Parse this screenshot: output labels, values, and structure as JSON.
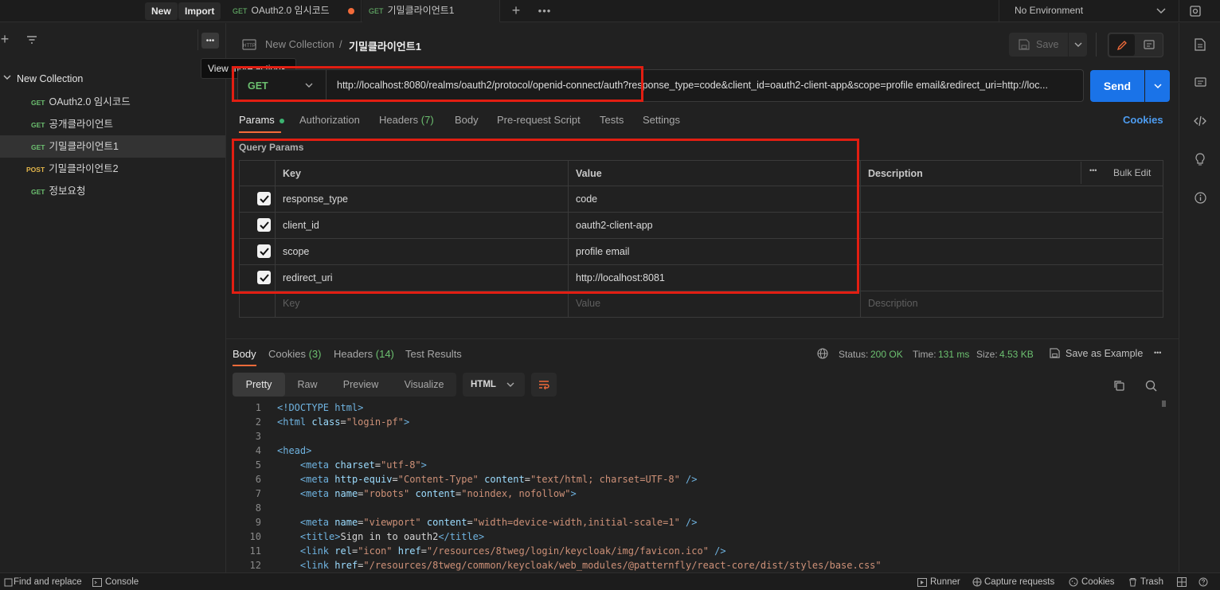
{
  "topbar": {
    "new_label": "New",
    "import_label": "Import",
    "tabs": [
      {
        "method": "GET",
        "name": "OAuth2.0 임시코드"
      },
      {
        "method": "GET",
        "name": "기밀클라이언트1"
      }
    ],
    "environment": "No Environment"
  },
  "sidebar": {
    "tooltip": "View more actions",
    "collection_name": "New Collection",
    "items": [
      {
        "method": "GET",
        "name": "OAuth2.0 임시코드"
      },
      {
        "method": "GET",
        "name": "공개클라이언트"
      },
      {
        "method": "GET",
        "name": "기밀클라이언트1"
      },
      {
        "method": "POST",
        "name": "기밀클라이언트2"
      },
      {
        "method": "GET",
        "name": "정보요청"
      }
    ]
  },
  "request": {
    "breadcrumb_collection": "New Collection",
    "breadcrumb_separator": "/",
    "breadcrumb_request": "기밀클라이언트1",
    "save_label": "Save",
    "method": "GET",
    "url": "http://localhost:8080/realms/oauth2/protocol/openid-connect/auth?response_type=code&client_id=oauth2-client-app&scope=profile email&redirect_uri=http://loc...",
    "send_label": "Send"
  },
  "request_tabs": {
    "params": "Params",
    "authorization": "Authorization",
    "headers": "Headers",
    "headers_count": "(7)",
    "body": "Body",
    "prerequest": "Pre-request Script",
    "tests": "Tests",
    "settings": "Settings",
    "cookies": "Cookies"
  },
  "params": {
    "title": "Query Params",
    "col_key": "Key",
    "col_value": "Value",
    "col_description": "Description",
    "bulk_edit": "Bulk Edit",
    "rows": [
      {
        "key": "response_type",
        "value": "code"
      },
      {
        "key": "client_id",
        "value": "oauth2-client-app"
      },
      {
        "key": "scope",
        "value": "profile email"
      },
      {
        "key": "redirect_uri",
        "value": "http://localhost:8081"
      }
    ],
    "ph_key": "Key",
    "ph_value": "Value",
    "ph_description": "Description"
  },
  "response": {
    "tabs": {
      "body": "Body",
      "cookies": "Cookies",
      "cookies_count": "(3)",
      "headers": "Headers",
      "headers_count": "(14)",
      "tests": "Test Results"
    },
    "status_label": "Status:",
    "status_value": "200 OK",
    "time_label": "Time:",
    "time_value": "131 ms",
    "size_label": "Size:",
    "size_value": "4.53 KB",
    "save_example": "Save as Example",
    "view_modes": [
      "Pretty",
      "Raw",
      "Preview",
      "Visualize"
    ],
    "format": "HTML"
  },
  "code_lines": [
    {
      "n": "1",
      "segs": [
        [
          "tg",
          "<!DOCTYPE html>"
        ]
      ]
    },
    {
      "n": "2",
      "segs": [
        [
          "tg",
          "<html "
        ],
        [
          "at",
          "class"
        ],
        [
          "tx",
          "="
        ],
        [
          "st",
          "\"login-pf\""
        ],
        [
          "tg",
          ">"
        ]
      ]
    },
    {
      "n": "3",
      "segs": []
    },
    {
      "n": "4",
      "segs": [
        [
          "tg",
          "<head>"
        ]
      ]
    },
    {
      "n": "5",
      "segs": [
        [
          "tx",
          "    "
        ],
        [
          "tg",
          "<meta "
        ],
        [
          "at",
          "charset"
        ],
        [
          "tx",
          "="
        ],
        [
          "st",
          "\"utf-8\""
        ],
        [
          "tg",
          ">"
        ]
      ]
    },
    {
      "n": "6",
      "segs": [
        [
          "tx",
          "    "
        ],
        [
          "tg",
          "<meta "
        ],
        [
          "at",
          "http-equiv"
        ],
        [
          "tx",
          "="
        ],
        [
          "st",
          "\"Content-Type\""
        ],
        [
          "tx",
          " "
        ],
        [
          "at",
          "content"
        ],
        [
          "tx",
          "="
        ],
        [
          "st",
          "\"text/html; charset=UTF-8\""
        ],
        [
          "tg",
          " />"
        ]
      ]
    },
    {
      "n": "7",
      "segs": [
        [
          "tx",
          "    "
        ],
        [
          "tg",
          "<meta "
        ],
        [
          "at",
          "name"
        ],
        [
          "tx",
          "="
        ],
        [
          "st",
          "\"robots\""
        ],
        [
          "tx",
          " "
        ],
        [
          "at",
          "content"
        ],
        [
          "tx",
          "="
        ],
        [
          "st",
          "\"noindex, nofollow\""
        ],
        [
          "tg",
          ">"
        ]
      ]
    },
    {
      "n": "8",
      "segs": []
    },
    {
      "n": "9",
      "segs": [
        [
          "tx",
          "    "
        ],
        [
          "tg",
          "<meta "
        ],
        [
          "at",
          "name"
        ],
        [
          "tx",
          "="
        ],
        [
          "st",
          "\"viewport\""
        ],
        [
          "tx",
          " "
        ],
        [
          "at",
          "content"
        ],
        [
          "tx",
          "="
        ],
        [
          "st",
          "\"width=device-width,initial-scale=1\""
        ],
        [
          "tg",
          " />"
        ]
      ]
    },
    {
      "n": "10",
      "segs": [
        [
          "tx",
          "    "
        ],
        [
          "tg",
          "<title>"
        ],
        [
          "tx",
          "Sign in to oauth2"
        ],
        [
          "tg",
          "</title>"
        ]
      ]
    },
    {
      "n": "11",
      "segs": [
        [
          "tx",
          "    "
        ],
        [
          "tg",
          "<link "
        ],
        [
          "at",
          "rel"
        ],
        [
          "tx",
          "="
        ],
        [
          "st",
          "\"icon\""
        ],
        [
          "tx",
          " "
        ],
        [
          "at",
          "href"
        ],
        [
          "tx",
          "="
        ],
        [
          "st",
          "\"/resources/8tweg/login/keycloak/img/favicon.ico\""
        ],
        [
          "tg",
          " />"
        ]
      ]
    },
    {
      "n": "12",
      "segs": [
        [
          "tx",
          "    "
        ],
        [
          "tg",
          "<link "
        ],
        [
          "at",
          "href"
        ],
        [
          "tx",
          "="
        ],
        [
          "st",
          "\"/resources/8tweg/common/keycloak/web_modules/@patternfly/react-core/dist/styles/base.css\""
        ]
      ]
    }
  ],
  "statusbar": {
    "find_replace": "Find and replace",
    "console": "Console",
    "runner": "Runner",
    "capture": "Capture requests",
    "cookies": "Cookies",
    "trash": "Trash"
  }
}
